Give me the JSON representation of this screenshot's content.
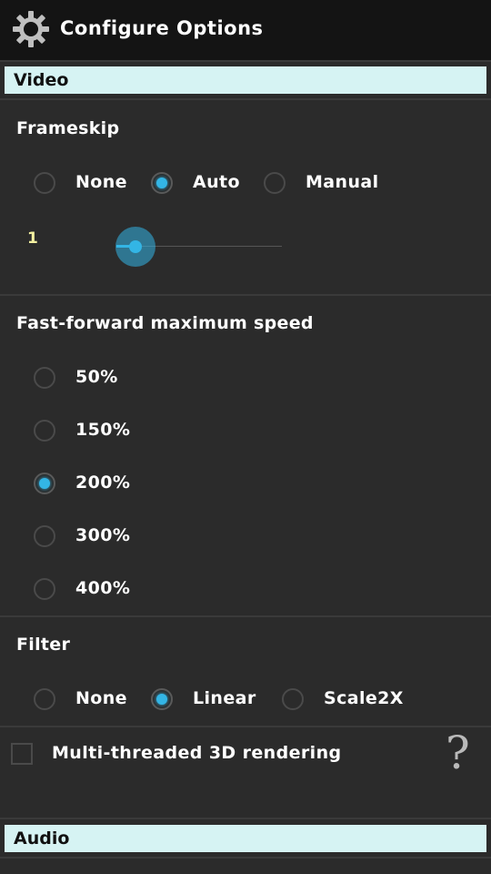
{
  "header": {
    "title": "Configure Options",
    "icon": "gear-icon"
  },
  "video": {
    "section_label": "Video",
    "frameskip": {
      "title": "Frameskip",
      "options": [
        "None",
        "Auto",
        "Manual"
      ],
      "selected": "Auto",
      "slider_value": "1"
    },
    "fastforward": {
      "title": "Fast-forward maximum speed",
      "options": [
        "50%",
        "150%",
        "200%",
        "300%",
        "400%"
      ],
      "selected": "200%"
    },
    "filter": {
      "title": "Filter",
      "options": [
        "None",
        "Linear",
        "Scale2X"
      ],
      "selected": "Linear"
    },
    "multithreaded": {
      "label": "Multi-threaded 3D rendering",
      "checked": false,
      "help_icon": "?"
    }
  },
  "audio": {
    "section_label": "Audio"
  },
  "colors": {
    "accent": "#33b5e5",
    "section_bar": "#d6f3f3",
    "background": "#2b2b2b"
  }
}
